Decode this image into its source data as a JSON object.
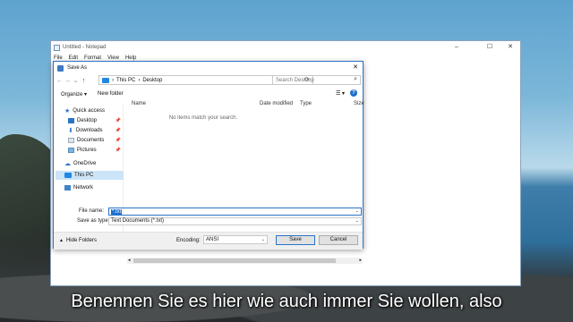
{
  "notepad": {
    "title": "Untitled - Notepad",
    "menu": [
      "File",
      "Edit",
      "Format",
      "View",
      "Help"
    ],
    "controls": {
      "minimize": "–",
      "maximize": "☐",
      "close": "✕"
    }
  },
  "dialog": {
    "title": "Save As",
    "close": "✕",
    "address": {
      "crumbs": [
        "This PC",
        "Desktop"
      ],
      "sep": "›"
    },
    "search_placeholder": "Search Desktop",
    "toolbar": {
      "organize": "Organize ▾",
      "new_folder": "New folder"
    },
    "nav": {
      "quick_access": "Quick access",
      "items": [
        "Desktop",
        "Downloads",
        "Documents",
        "Pictures"
      ],
      "onedrive": "OneDrive",
      "this_pc": "This PC",
      "network": "Network"
    },
    "columns": [
      "Name",
      "Date modified",
      "Type",
      "Size"
    ],
    "empty_message": "No items match your search.",
    "file_name_label": "File name:",
    "file_name_value": "*.txt",
    "save_as_type_label": "Save as type:",
    "save_as_type_value": "Text Documents (*.txt)",
    "hide_folders": "Hide Folders",
    "encoding_label": "Encoding:",
    "encoding_value": "ANSI",
    "save": "Save",
    "cancel": "Cancel"
  },
  "subtitle": "Benennen Sie es hier wie auch immer Sie wollen, also",
  "colors": {
    "accent": "#1e6fd0",
    "selection": "#cce4f7",
    "folder": "#e8b84a"
  }
}
